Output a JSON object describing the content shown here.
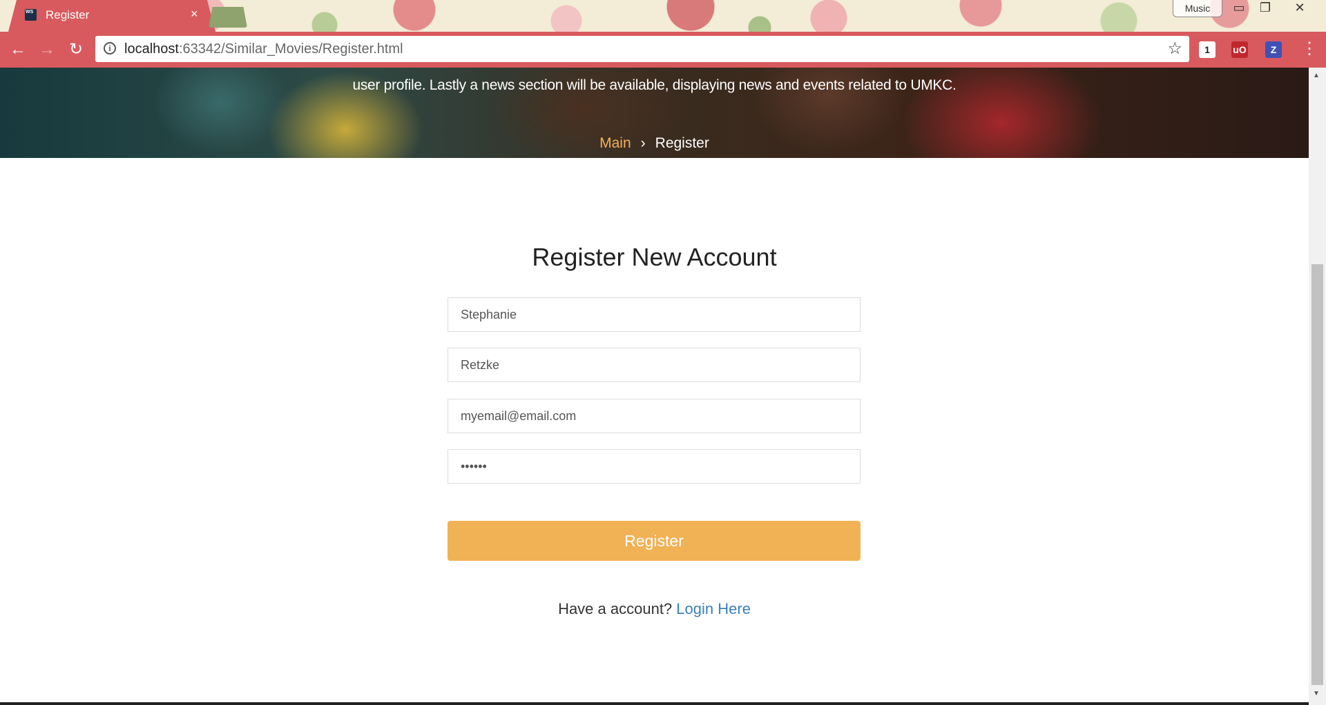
{
  "browser": {
    "tab_title": "Register",
    "tab_close": "×",
    "favicon_text": "WS",
    "music_label": "Music",
    "url_host": "localhost",
    "url_rest": ":63342/Similar_Movies/Register.html",
    "nav": {
      "back": "←",
      "forward": "→",
      "reload": "↻"
    },
    "window_controls": {
      "minimize": "▭",
      "restore": "❐",
      "close": "✕"
    },
    "extensions": [
      {
        "label": "1",
        "color": "#ffffff"
      },
      {
        "label": "uO",
        "color": "#c0272d"
      },
      {
        "label": "Z",
        "color": "#3f51b5"
      }
    ],
    "ublock_badge": "1",
    "menu": "⋮"
  },
  "hero": {
    "text": "user profile. Lastly a news section will be available, displaying news and events related to UMKC.",
    "breadcrumb": {
      "main": "Main",
      "separator": "›",
      "current": "Register"
    }
  },
  "form": {
    "title": "Register New Account",
    "first_name": "Stephanie",
    "last_name": "Retzke",
    "email": "myemail@email.com",
    "password": "••••••",
    "submit_label": "Register",
    "login_prompt": "Have a account?",
    "login_link": "Login Here"
  },
  "colors": {
    "browser_chrome": "#d85a5e",
    "accent": "#f0b254",
    "link": "#3b7fb8"
  }
}
